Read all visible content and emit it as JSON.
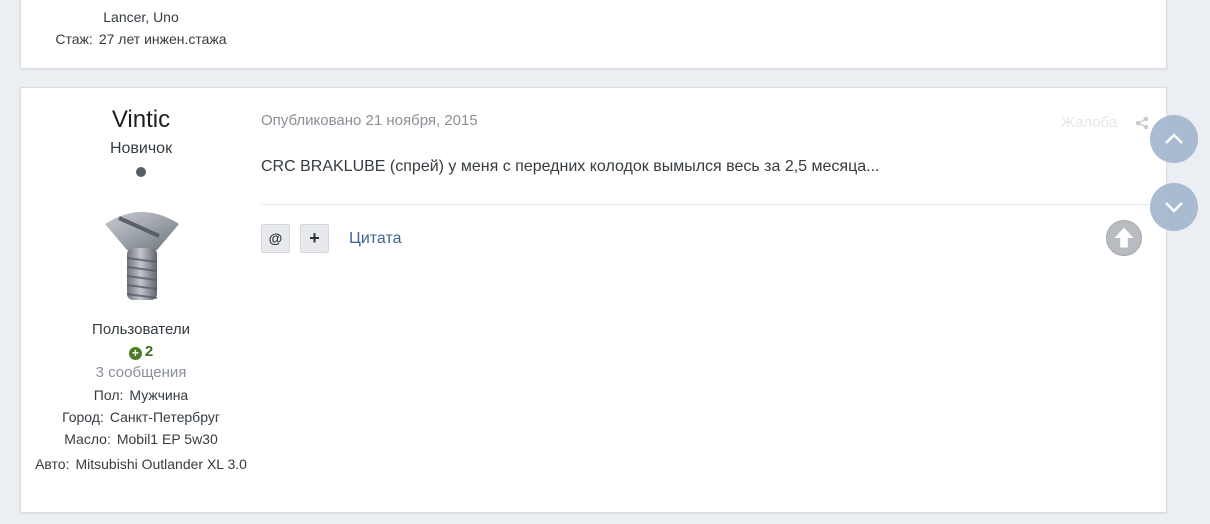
{
  "prev_author": {
    "cars_label": "",
    "cars_value": "Lancer, Uno",
    "experience_label": "Стаж:",
    "experience_value": "27 лет инжен.стажа"
  },
  "author": {
    "username": "Vintic",
    "rank": "Новичок",
    "avatar_icon": "screw-avatar",
    "group": "Пользователи",
    "reputation": "2",
    "posts_count": "3 сообщения",
    "fields": [
      {
        "label": "Пол:",
        "value": "Мужчина"
      },
      {
        "label": "Город:",
        "value": "Санкт-Петербруг"
      },
      {
        "label": "Масло:",
        "value": "Mobil1 EP 5w30"
      },
      {
        "label": "Авто:",
        "value": "Mitsubishi Outlander XL 3.0"
      }
    ]
  },
  "post": {
    "published": "Опубликовано 21 ноября, 2015",
    "report_label": "Жалоба",
    "content": "CRC BRAKLUBE (спрей) у меня с передних колодок вымылся весь за 2,5 месяца...",
    "mention_label": "@",
    "add_label": "+",
    "quote_label": "Цитата"
  },
  "colors": {
    "accent": "#3d6594",
    "reputation": "#3e6b1f",
    "nav_button": "#a6b9cf"
  }
}
